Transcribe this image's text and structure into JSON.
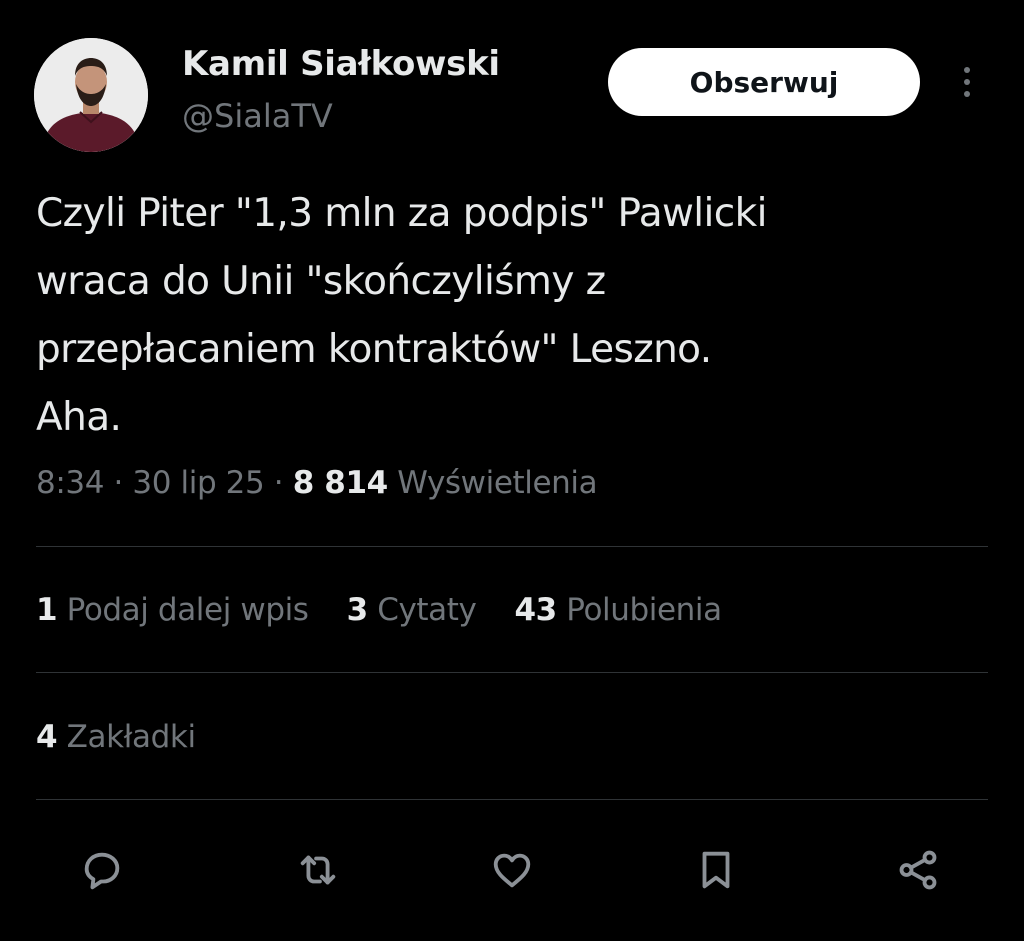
{
  "author": {
    "display_name": "Kamil Siałkowski",
    "handle": "@SialaTV"
  },
  "follow_button_label": "Obserwuj",
  "tweet": {
    "text_lines": [
      "Czyli Piter \"1,3 mln za podpis\" Pawlicki",
      "wraca do Unii \"skończyliśmy z",
      "przepłacaniem kontraktów\" Leszno.",
      "Aha."
    ],
    "time": "8:34",
    "date": "30 lip 25",
    "separator": "·",
    "views_count": "8 814",
    "views_label": "Wyświetlenia"
  },
  "stats": {
    "reposts_count": "1",
    "reposts_label": "Podaj dalej wpis",
    "quotes_count": "3",
    "quotes_label": "Cytaty",
    "likes_count": "43",
    "likes_label": "Polubienia",
    "bookmarks_count": "4",
    "bookmarks_label": "Zakładki"
  },
  "actions": [
    "reply-icon",
    "repost-icon",
    "like-icon",
    "bookmark-icon",
    "share-icon"
  ],
  "colors": {
    "background": "#000000",
    "primary_text": "#e7e9ea",
    "secondary_text": "#71767b",
    "divider": "#2f3336",
    "follow_button_bg": "#ffffff"
  }
}
